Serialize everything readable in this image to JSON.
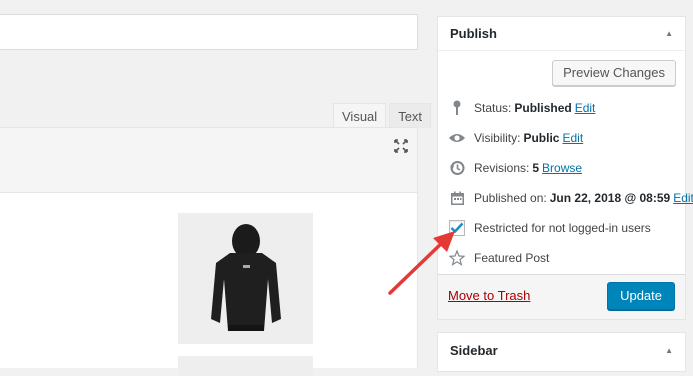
{
  "editor": {
    "tabs": [
      {
        "label": "Visual"
      },
      {
        "label": "Text"
      }
    ]
  },
  "publish": {
    "title": "Publish",
    "preview_label": "Preview Changes",
    "status": {
      "label": "Status:",
      "value": "Published",
      "link": "Edit"
    },
    "visibility": {
      "label": "Visibility:",
      "value": "Public",
      "link": "Edit"
    },
    "revisions": {
      "label": "Revisions:",
      "value": "5",
      "link": "Browse"
    },
    "published_on": {
      "label": "Published on:",
      "value": "Jun 22, 2018 @ 08:59",
      "link": "Edit"
    },
    "restricted": {
      "label": "Restricted for not logged-in users",
      "checked": true
    },
    "featured": {
      "label": "Featured Post"
    },
    "trash_label": "Move to Trash",
    "update_label": "Update"
  },
  "sidebar_box": {
    "title": "Sidebar"
  },
  "colors": {
    "accent": "#0085ba",
    "link": "#0073aa",
    "trash": "#a00",
    "arrow": "#e53935"
  }
}
